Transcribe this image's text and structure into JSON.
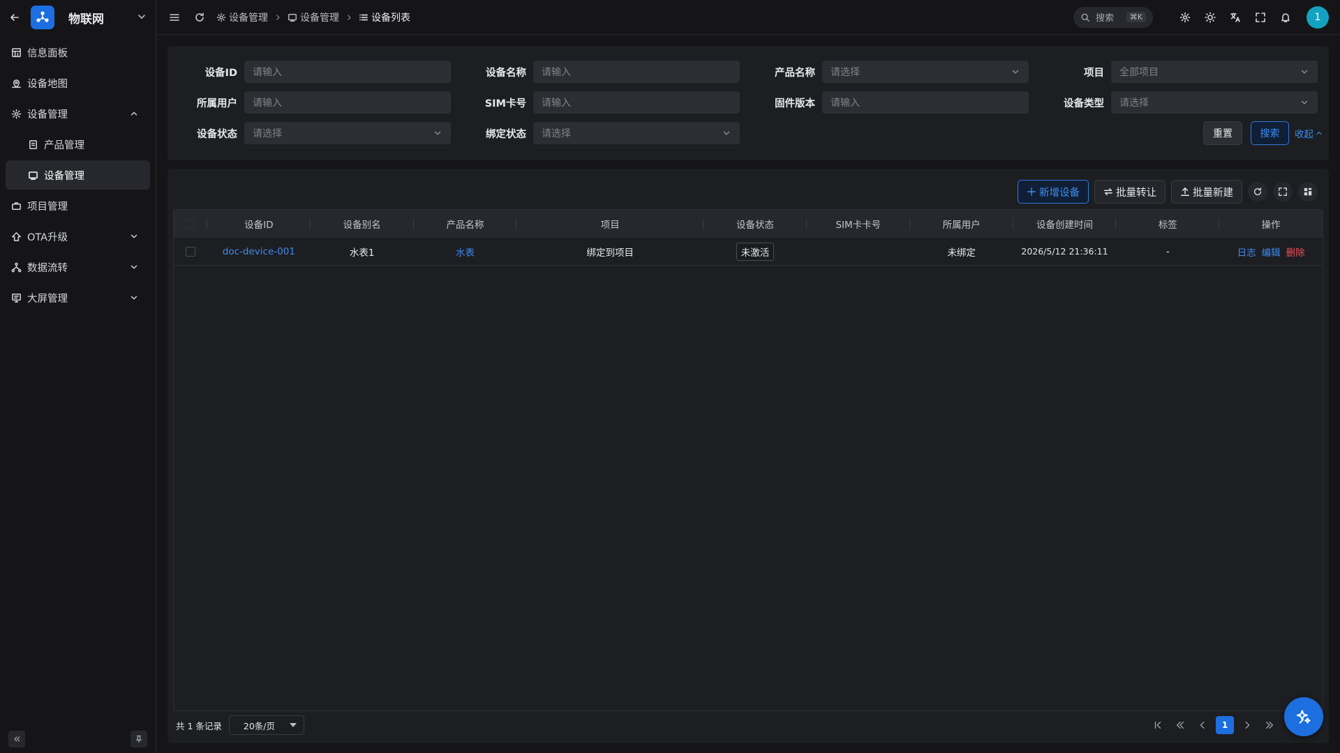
{
  "app": {
    "title": "物联网"
  },
  "sidebar": {
    "items": [
      {
        "label": "信息面板",
        "icon": "dashboard-icon"
      },
      {
        "label": "设备地图",
        "icon": "map-icon"
      },
      {
        "label": "设备管理",
        "icon": "gear-icon",
        "expanded": true
      },
      {
        "label": "产品管理",
        "icon": "product-icon",
        "sub": true
      },
      {
        "label": "设备管理",
        "icon": "device-icon",
        "sub": true,
        "active": true
      },
      {
        "label": "项目管理",
        "icon": "briefcase-icon"
      },
      {
        "label": "OTA升级",
        "icon": "upgrade-icon"
      },
      {
        "label": "数据流转",
        "icon": "flow-icon"
      },
      {
        "label": "大屏管理",
        "icon": "screen-icon"
      }
    ]
  },
  "topbar": {
    "breadcrumb": [
      "设备管理",
      "设备管理",
      "设备列表"
    ],
    "search_label": "搜索",
    "search_kbd": "⌘K",
    "avatar": "1"
  },
  "filter": {
    "fields": {
      "device_id": {
        "label": "设备ID",
        "placeholder": "请输入"
      },
      "device_name": {
        "label": "设备名称",
        "placeholder": "请输入"
      },
      "product_name": {
        "label": "产品名称",
        "placeholder": "请选择"
      },
      "project": {
        "label": "项目",
        "value": "全部项目"
      },
      "owner": {
        "label": "所属用户",
        "placeholder": "请输入"
      },
      "sim": {
        "label": "SIM卡号",
        "placeholder": "请输入"
      },
      "firmware": {
        "label": "固件版本",
        "placeholder": "请输入"
      },
      "device_type": {
        "label": "设备类型",
        "placeholder": "请选择"
      },
      "device_status": {
        "label": "设备状态",
        "placeholder": "请选择"
      },
      "bind_status": {
        "label": "绑定状态",
        "placeholder": "请选择"
      }
    },
    "reset_label": "重置",
    "search_label": "搜索",
    "collapse_label": "收起"
  },
  "toolbar": {
    "add_label": "新增设备",
    "transfer_label": "批量转让",
    "import_label": "批量新建"
  },
  "table": {
    "columns": [
      "设备ID",
      "设备别名",
      "产品名称",
      "项目",
      "设备状态",
      "SIM卡卡号",
      "所属用户",
      "设备创建时间",
      "标签",
      "操作"
    ],
    "rows": [
      {
        "device_id": "doc-device-001",
        "alias": "水表1",
        "product": "水表",
        "project": "绑定到项目",
        "status": "未激活",
        "sim": "",
        "owner": "未绑定",
        "created": "2026/5/12 21:36:11",
        "tags": "-",
        "ops": {
          "log": "日志",
          "edit": "编辑",
          "delete": "删除"
        }
      }
    ]
  },
  "pager": {
    "total": "共 1 条记录",
    "page_size": "20条/页",
    "current": "1"
  },
  "colors": {
    "accent": "#1d6fe0",
    "danger": "#ee4d5b",
    "bg": "#151517",
    "panel": "#1d1e22"
  }
}
